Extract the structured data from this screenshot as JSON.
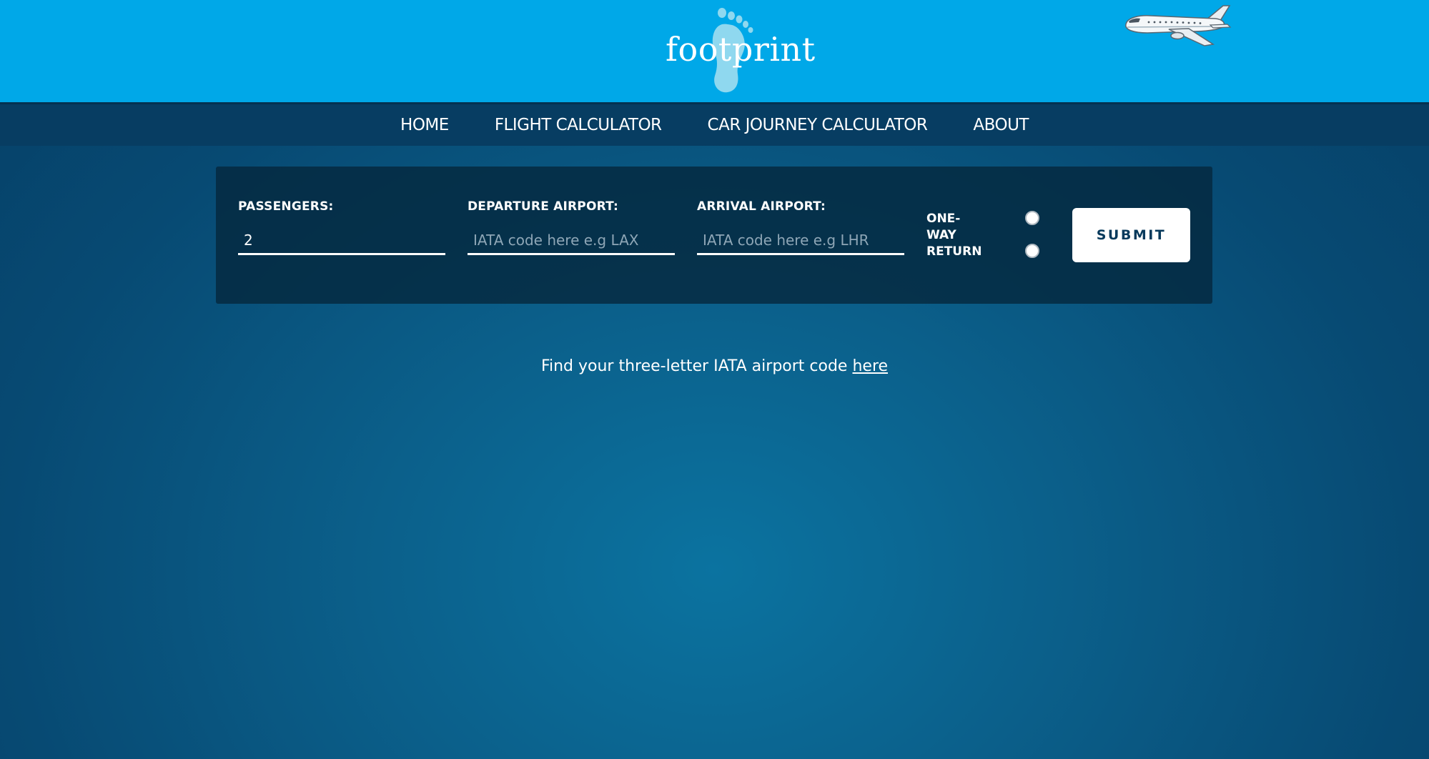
{
  "brand": {
    "logo_text": "footprint",
    "logo_icon": "footprint-icon",
    "header_image": "airplane-icon",
    "header_color": "#00a8e8"
  },
  "nav": {
    "items": [
      {
        "label": "HOME"
      },
      {
        "label": "FLIGHT CALCULATOR"
      },
      {
        "label": "CAR JOURNEY CALCULATOR"
      },
      {
        "label": "ABOUT"
      }
    ]
  },
  "form": {
    "passengers": {
      "label": "PASSENGERS:",
      "value": "2"
    },
    "departure": {
      "label": "DEPARTURE AIRPORT:",
      "value": "",
      "placeholder": "IATA code here e.g LAX"
    },
    "arrival": {
      "label": "ARRIVAL AIRPORT:",
      "value": "",
      "placeholder": "IATA code here e.g LHR"
    },
    "trip_type": {
      "one_way_label": "ONE-WAY",
      "return_label": "RETURN"
    },
    "submit_label": "SUBMIT"
  },
  "info": {
    "text": "Find your three-letter IATA airport code ",
    "link_text": "here"
  }
}
